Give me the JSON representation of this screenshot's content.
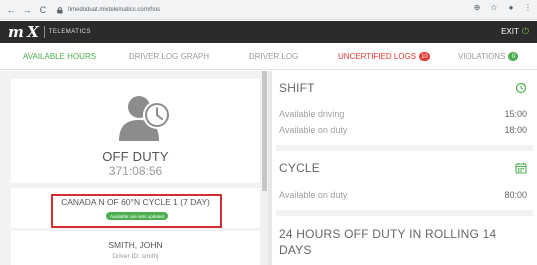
{
  "browser": {
    "url": "timedoduat.mixtelematics.com/hos",
    "nav": [
      "←",
      "→",
      "C",
      "⌂"
    ],
    "actions": [
      "⊕",
      "☆",
      "●",
      "⋮"
    ]
  },
  "header": {
    "brand_mark": "m X",
    "brand_text": "TELEMATICS",
    "exit_label": "EXIT"
  },
  "tabs": [
    {
      "label": "AVAILABLE HOURS",
      "active": true
    },
    {
      "label": "DRIVER LOG GRAPH",
      "active": false
    },
    {
      "label": "DRIVER LOG",
      "active": false
    },
    {
      "label": "UNCERTIFIED LOGS",
      "active": false,
      "badge": "10"
    },
    {
      "label": "VIOLATIONS",
      "active": false,
      "badge": "0"
    }
  ],
  "status": {
    "state": "OFF DUTY",
    "duration": "371:08:56"
  },
  "cycle": {
    "label": "CANADA N OF 60°N CYCLE 1 (7 DAY)",
    "pill": "Available rule sets updated"
  },
  "driver": {
    "name": "SMITH, JOHN",
    "id_label": "Driver ID: smithj"
  },
  "shift": {
    "title": "SHIFT",
    "rows": [
      {
        "label": "Available driving",
        "value": "15:00"
      },
      {
        "label": "Available on duty",
        "value": "18:00"
      }
    ]
  },
  "cycle_section": {
    "title": "CYCLE",
    "rows": [
      {
        "label": "Available on duty",
        "value": "80:00"
      }
    ]
  },
  "off_duty_section": {
    "title": "24 HOURS OFF DUTY IN ROLLING 14 DAYS"
  },
  "colors": {
    "header_bg": "#2b2b2b",
    "active_green": "#4caf50",
    "alert_red": "#e53935",
    "highlight_box": "#d32f2f"
  }
}
